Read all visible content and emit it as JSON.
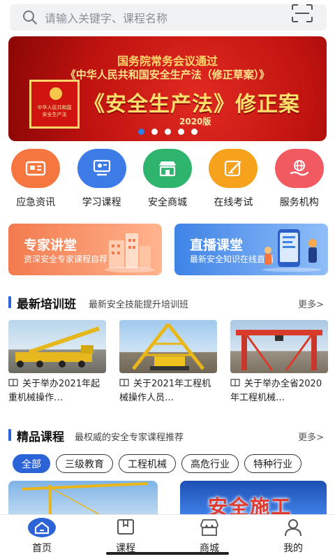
{
  "search": {
    "placeholder": "请输入关键字、课程名称",
    "icon": "search-icon",
    "scan_icon": "scan-icon"
  },
  "banner": {
    "line1": "国务院常务会议通过",
    "line2": "《中华人民共和国安全生产法（修正草案）》",
    "book_line1": "中华人民共和国",
    "book_line2": "安全生产法",
    "headline": "《安全生产法》修正案",
    "version": "2020版",
    "slide_count": 5,
    "active_slide": 1
  },
  "quicknav": [
    {
      "label": "应急资讯",
      "color": "#f5773f",
      "icon": "news-icon"
    },
    {
      "label": "学习课程",
      "color": "#3d7be6",
      "icon": "classroom-icon"
    },
    {
      "label": "安全商城",
      "color": "#2fb46e",
      "icon": "store-icon"
    },
    {
      "label": "在线考试",
      "color": "#f6a21d",
      "icon": "exam-icon"
    },
    {
      "label": "服务机构",
      "color": "#f05a60",
      "icon": "service-icon"
    }
  ],
  "promos": [
    {
      "title": "专家讲堂",
      "subtitle": "资深安全专家课程自荐"
    },
    {
      "title": "直播课堂",
      "subtitle": "最新安全知识在线直播"
    }
  ],
  "training": {
    "title": "最新培训班",
    "subtitle": "最新安全技能提升培训班",
    "more": "更多>",
    "items": [
      {
        "text": "关于举办2021年起重机械操作…"
      },
      {
        "text": "关于2021年工程机械操作人员…"
      },
      {
        "text": "关于举办全省2020年工程机械…"
      }
    ]
  },
  "courses": {
    "title": "精品课程",
    "subtitle": "最权威的安全专家课程推荐",
    "more": "更多>",
    "tags": [
      "全部",
      "三级教育",
      "工程机械",
      "高危行业",
      "特种行业"
    ],
    "active_tag": "全部",
    "thumb2_text": "安全施工"
  },
  "tabbar": [
    {
      "label": "首页",
      "icon": "home-icon",
      "active": true
    },
    {
      "label": "课程",
      "icon": "book-icon",
      "active": false
    },
    {
      "label": "商城",
      "icon": "shop-icon",
      "active": false
    },
    {
      "label": "我的",
      "icon": "user-icon",
      "active": false
    }
  ],
  "colors": {
    "accent": "#2c63d6",
    "banner_red": "#c0130f",
    "gold": "#ffe06b"
  }
}
